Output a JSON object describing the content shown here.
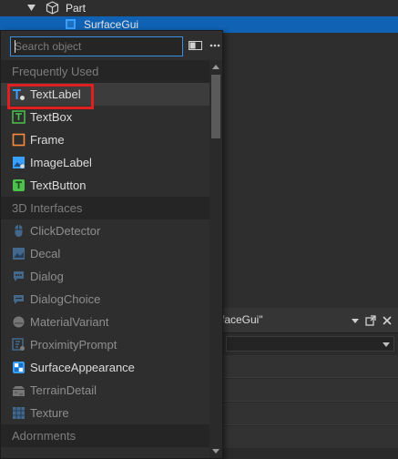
{
  "explorer": {
    "part_label": "Part",
    "surfacegui_label": "SurfaceGui"
  },
  "properties": {
    "title_fragment": "rfaceGui\""
  },
  "popup": {
    "search_placeholder": "Search object",
    "sections": {
      "frequently_used": "Frequently Used",
      "interfaces_3d": "3D Interfaces",
      "adornments": "Adornments"
    },
    "frequent_items": [
      {
        "label": "TextLabel",
        "icon": "textlabel-icon",
        "color": "#3aa0ff"
      },
      {
        "label": "TextBox",
        "icon": "textbox-icon",
        "color": "#4cc24c"
      },
      {
        "label": "Frame",
        "icon": "frame-icon",
        "color": "#ff8a3c"
      },
      {
        "label": "ImageLabel",
        "icon": "imagelabel-icon",
        "color": "#3aa0ff"
      },
      {
        "label": "TextButton",
        "icon": "textbutton-icon",
        "color": "#4cc24c"
      }
    ],
    "interface_items": [
      {
        "label": "ClickDetector",
        "icon": "clickdetector-icon",
        "enabled": false
      },
      {
        "label": "Decal",
        "icon": "decal-icon",
        "enabled": false
      },
      {
        "label": "Dialog",
        "icon": "dialog-icon",
        "enabled": false
      },
      {
        "label": "DialogChoice",
        "icon": "dialogchoice-icon",
        "enabled": false
      },
      {
        "label": "MaterialVariant",
        "icon": "materialvariant-icon",
        "enabled": false
      },
      {
        "label": "ProximityPrompt",
        "icon": "proximityprompt-icon",
        "enabled": false
      },
      {
        "label": "SurfaceAppearance",
        "icon": "surfaceappearance-icon",
        "enabled": true
      },
      {
        "label": "TerrainDetail",
        "icon": "terraindetail-icon",
        "enabled": false
      },
      {
        "label": "Texture",
        "icon": "texture-icon",
        "enabled": false
      }
    ]
  },
  "colors": {
    "accent": "#0f62b4",
    "search_border": "#3a8ee6",
    "highlight": "#e02020"
  }
}
